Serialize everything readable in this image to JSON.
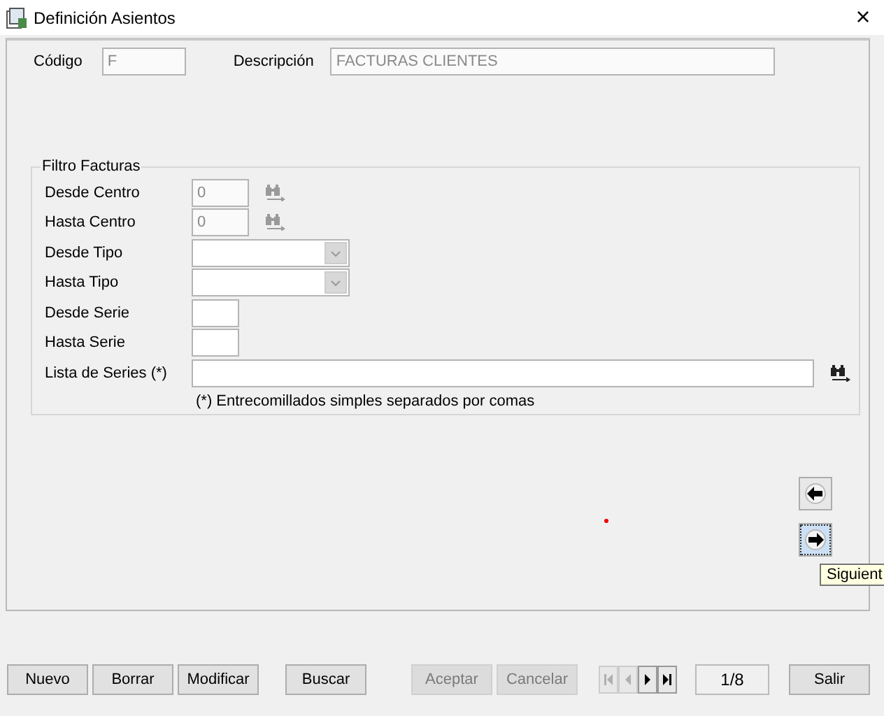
{
  "window": {
    "title": "Definición Asientos",
    "close": "×"
  },
  "header": {
    "code_label": "Código",
    "code_value": "F",
    "description_label": "Descripción",
    "description_value": "FACTURAS CLIENTES"
  },
  "filter": {
    "title": "Filtro Facturas",
    "rows": [
      {
        "kind": "lookup",
        "label": "Desde Centro",
        "value": "0"
      },
      {
        "kind": "lookup",
        "label": "Hasta Centro",
        "value": "0"
      },
      {
        "kind": "combo",
        "label": "Desde Tipo"
      },
      {
        "kind": "combo",
        "label": "Hasta Tipo"
      },
      {
        "kind": "short",
        "label": "Desde Serie"
      },
      {
        "kind": "short",
        "label": "Hasta Serie"
      },
      {
        "kind": "wide",
        "label": "Lista de Series (*)"
      }
    ],
    "note": "(*) Entrecomillados simples separados por comas"
  },
  "side_buttons": [
    {
      "kind": "previous",
      "selected": false
    },
    {
      "kind": "next",
      "selected": true
    }
  ],
  "tooltip": "Siguient",
  "buttons": [
    {
      "label": "Nuevo",
      "disabled": false
    },
    {
      "label": "Borrar",
      "disabled": false
    },
    {
      "label": "Modificar",
      "disabled": false
    },
    {
      "label": "Buscar",
      "disabled": false
    },
    {
      "label": "Aceptar",
      "disabled": true
    },
    {
      "label": "Cancelar",
      "disabled": true
    }
  ],
  "nav": [
    {
      "kind": "first",
      "disabled": true
    },
    {
      "kind": "previous",
      "disabled": true
    },
    {
      "kind": "next",
      "disabled": false
    },
    {
      "kind": "last",
      "disabled": false
    }
  ],
  "record_counter": "1/8",
  "exit_button": {
    "label": "Salir",
    "disabled": false
  }
}
